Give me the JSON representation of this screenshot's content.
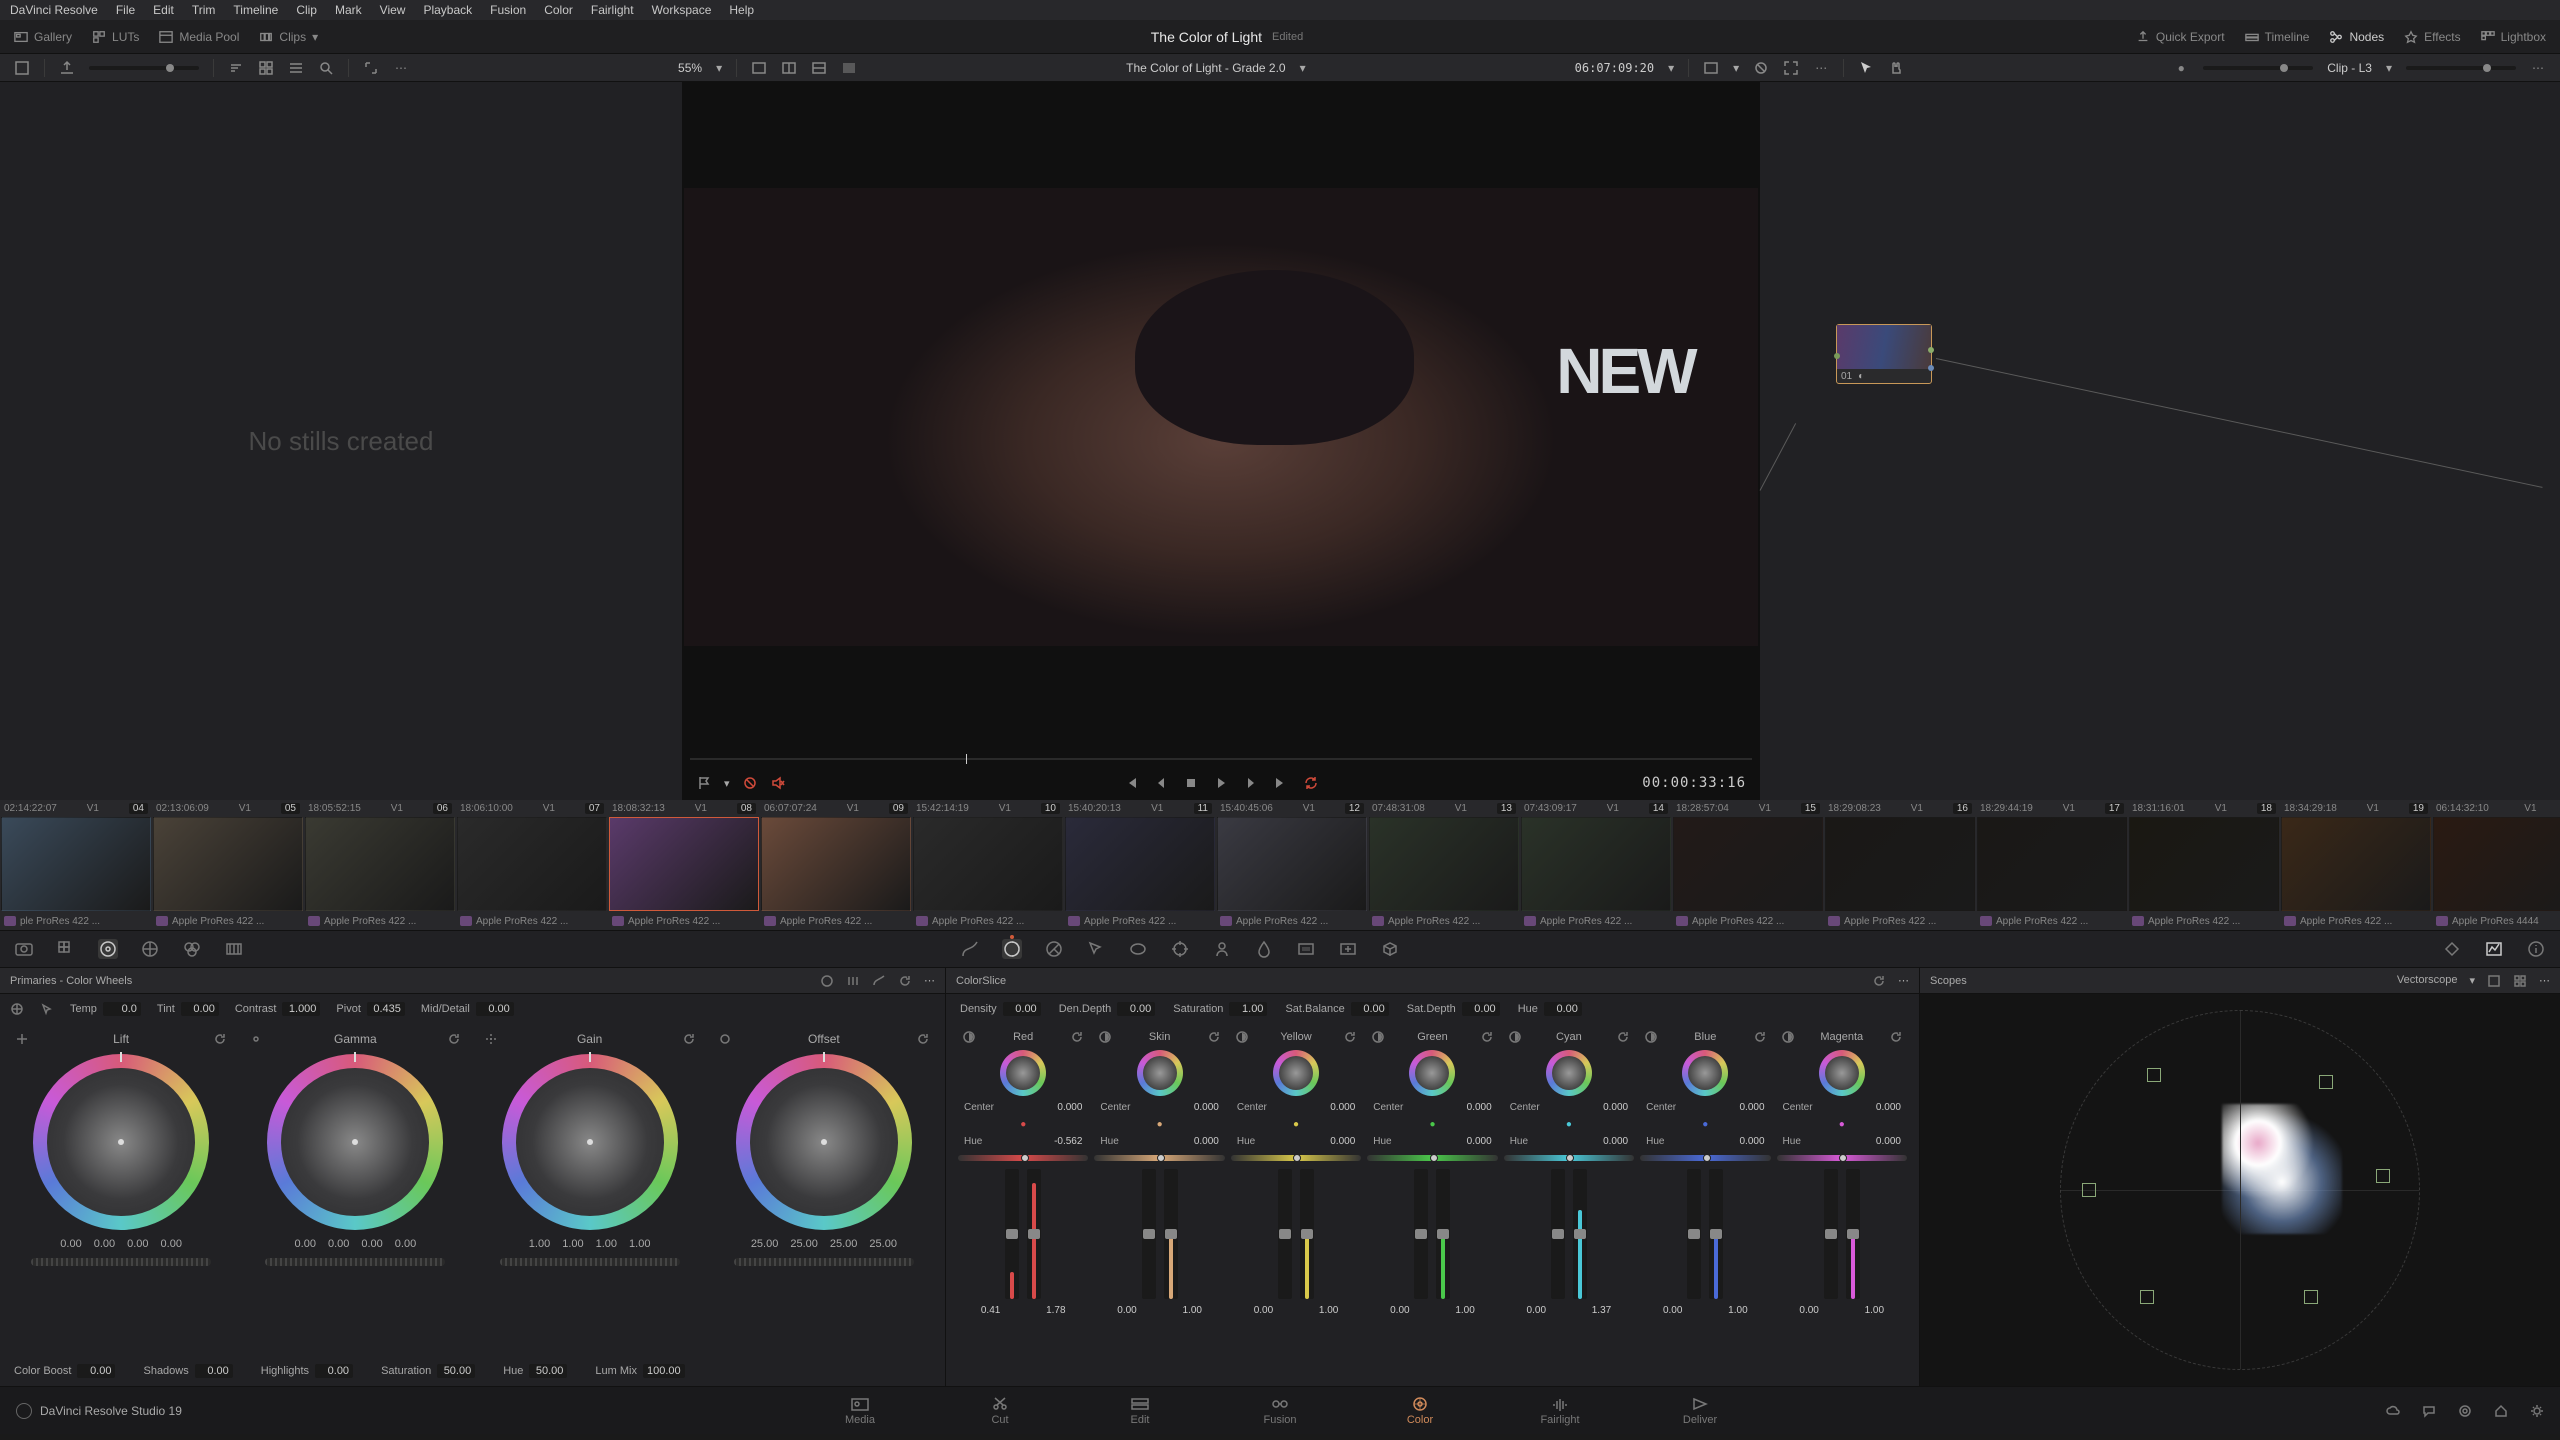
{
  "app_name": "DaVinci Resolve",
  "menus": [
    "File",
    "Edit",
    "Trim",
    "Timeline",
    "Clip",
    "Mark",
    "View",
    "Playback",
    "Fusion",
    "Color",
    "Fairlight",
    "Workspace",
    "Help"
  ],
  "header": {
    "left": [
      {
        "icon": "gallery-icon",
        "label": "Gallery"
      },
      {
        "icon": "luts-icon",
        "label": "LUTs"
      },
      {
        "icon": "mediapool-icon",
        "label": "Media Pool"
      },
      {
        "icon": "clips-icon",
        "label": "Clips",
        "caret": true
      }
    ],
    "title": "The Color of Light",
    "edited": "Edited",
    "right": [
      {
        "icon": "export-icon",
        "label": "Quick Export"
      },
      {
        "icon": "timeline-icon",
        "label": "Timeline"
      },
      {
        "icon": "nodes-icon",
        "label": "Nodes"
      },
      {
        "icon": "effects-icon",
        "label": "Effects"
      },
      {
        "icon": "lightbox-icon",
        "label": "Lightbox"
      }
    ]
  },
  "subheader": {
    "zoom": "55%",
    "timeline_name": "The Color of Light - Grade 2.0",
    "timecode": "06:07:09:20",
    "clip_label": "Clip - L3"
  },
  "gallery_empty": "No stills created",
  "viewer": {
    "playhead_pct": 26,
    "duration_tc": "00:00:33:16"
  },
  "nodes": {
    "node_num": "01",
    "node_icon": "grade-icon"
  },
  "clips": [
    {
      "tc": "02:14:22:07",
      "trk": "V1",
      "num": "04",
      "codec": "ple ProRes 422 ..."
    },
    {
      "tc": "02:13:06:09",
      "trk": "V1",
      "num": "05",
      "codec": "Apple ProRes 422 ..."
    },
    {
      "tc": "18:05:52:15",
      "trk": "V1",
      "num": "06",
      "codec": "Apple ProRes 422 ..."
    },
    {
      "tc": "18:06:10:00",
      "trk": "V1",
      "num": "07",
      "codec": "Apple ProRes 422 ..."
    },
    {
      "tc": "18:08:32:13",
      "trk": "V1",
      "num": "08",
      "codec": "Apple ProRes 422 ...",
      "selected": true
    },
    {
      "tc": "06:07:07:24",
      "trk": "V1",
      "num": "09",
      "codec": "Apple ProRes 422 ..."
    },
    {
      "tc": "15:42:14:19",
      "trk": "V1",
      "num": "10",
      "codec": "Apple ProRes 422 ..."
    },
    {
      "tc": "15:40:20:13",
      "trk": "V1",
      "num": "11",
      "codec": "Apple ProRes 422 ..."
    },
    {
      "tc": "15:40:45:06",
      "trk": "V1",
      "num": "12",
      "codec": "Apple ProRes 422 ..."
    },
    {
      "tc": "07:48:31:08",
      "trk": "V1",
      "num": "13",
      "codec": "Apple ProRes 422 ..."
    },
    {
      "tc": "07:43:09:17",
      "trk": "V1",
      "num": "14",
      "codec": "Apple ProRes 422 ..."
    },
    {
      "tc": "18:28:57:04",
      "trk": "V1",
      "num": "15",
      "codec": "Apple ProRes 422 ..."
    },
    {
      "tc": "18:29:08:23",
      "trk": "V1",
      "num": "16",
      "codec": "Apple ProRes 422 ..."
    },
    {
      "tc": "18:29:44:19",
      "trk": "V1",
      "num": "17",
      "codec": "Apple ProRes 422 ..."
    },
    {
      "tc": "18:31:16:01",
      "trk": "V1",
      "num": "18",
      "codec": "Apple ProRes 422 ..."
    },
    {
      "tc": "18:34:29:18",
      "trk": "V1",
      "num": "19",
      "codec": "Apple ProRes 422 ..."
    },
    {
      "tc": "06:14:32:10",
      "trk": "V1",
      "num": "",
      "codec": "Apple ProRes 4444"
    }
  ],
  "clip_thumb_bg": [
    "#3a4a5a",
    "#4a4238",
    "#3a3a32",
    "#2a2a2a",
    "#5a3a6a",
    "#6a4a3a",
    "#2a2a2a",
    "#2a2a3a",
    "#3a3a42",
    "#2a3228",
    "#2a3228",
    "#221a18",
    "#1a1816",
    "#1a1816",
    "#1a1812",
    "#3a2818",
    "#2a1a12"
  ],
  "primaries": {
    "title": "Primaries - Color Wheels",
    "top": {
      "temp_label": "Temp",
      "temp": "0.0",
      "tint_label": "Tint",
      "tint": "0.00",
      "contrast_label": "Contrast",
      "contrast": "1.000",
      "pivot_label": "Pivot",
      "pivot": "0.435",
      "md_label": "Mid/Detail",
      "md": "0.00"
    },
    "wheels": [
      {
        "name": "Lift",
        "y": "0.00",
        "r": "0.00",
        "g": "0.00",
        "b": "0.00"
      },
      {
        "name": "Gamma",
        "y": "0.00",
        "r": "0.00",
        "g": "0.00",
        "b": "0.00"
      },
      {
        "name": "Gain",
        "y": "1.00",
        "r": "1.00",
        "g": "1.00",
        "b": "1.00"
      },
      {
        "name": "Offset",
        "y": "25.00",
        "r": "25.00",
        "g": "25.00",
        "b": "25.00"
      }
    ],
    "bottom": {
      "colboost_label": "Color Boost",
      "colboost": "0.00",
      "shad_label": "Shadows",
      "shad": "0.00",
      "hl_label": "Highlights",
      "hl": "0.00",
      "sat_label": "Saturation",
      "sat": "50.00",
      "hue_label": "Hue",
      "hue": "50.00",
      "lum_label": "Lum Mix",
      "lum": "100.00"
    }
  },
  "colorslice": {
    "title": "ColorSlice",
    "top": {
      "density_label": "Density",
      "density": "0.00",
      "dendepth_label": "Den.Depth",
      "dendepth": "0.00",
      "sat_label": "Saturation",
      "sat": "1.00",
      "satbal_label": "Sat.Balance",
      "satbal": "0.00",
      "satdepth_label": "Sat.Depth",
      "satdepth": "0.00",
      "hue_label": "Hue",
      "hue": "0.00"
    },
    "center_label": "Center",
    "hue_row_label": "Hue",
    "slices": [
      {
        "name": "Red",
        "center": "0.000",
        "hue": "-0.562",
        "v1": "0.41",
        "v2": "1.78",
        "accent": "#d84a4a"
      },
      {
        "name": "Skin",
        "center": "0.000",
        "hue": "0.000",
        "v1": "0.00",
        "v2": "1.00",
        "accent": "#d8a878"
      },
      {
        "name": "Yellow",
        "center": "0.000",
        "hue": "0.000",
        "v1": "0.00",
        "v2": "1.00",
        "accent": "#d8c84a"
      },
      {
        "name": "Green",
        "center": "0.000",
        "hue": "0.000",
        "v1": "0.00",
        "v2": "1.00",
        "accent": "#4ac84a"
      },
      {
        "name": "Cyan",
        "center": "0.000",
        "hue": "0.000",
        "v1": "0.00",
        "v2": "1.37",
        "accent": "#4ac8d8"
      },
      {
        "name": "Blue",
        "center": "0.000",
        "hue": "0.000",
        "v1": "0.00",
        "v2": "1.00",
        "accent": "#4a6ad8"
      },
      {
        "name": "Magenta",
        "center": "0.000",
        "hue": "0.000",
        "v1": "0.00",
        "v2": "1.00",
        "accent": "#d85ad8"
      }
    ]
  },
  "scopes": {
    "title": "Scopes",
    "mode": "Vectorscope"
  },
  "pagetabs": [
    "Media",
    "Cut",
    "Edit",
    "Fusion",
    "Color",
    "Fairlight",
    "Deliver"
  ],
  "pagetab_active": "Color",
  "statusbar": "DaVinci Resolve Studio 19"
}
